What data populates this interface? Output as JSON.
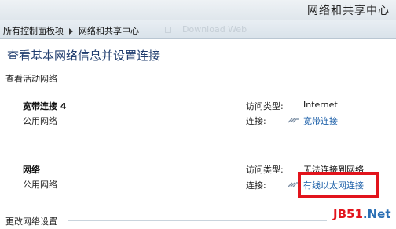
{
  "window": {
    "title": "网络和共享中心"
  },
  "address": {
    "crumb1": "所有控制面板项",
    "crumb2": "网络和共享中心",
    "ghost_text": "Download Web"
  },
  "page": {
    "title": "查看基本网络信息并设置连接"
  },
  "sections": {
    "active": "查看活动网络",
    "change": "更改网络设置"
  },
  "networks": [
    {
      "name": "宽带连接 4",
      "type": "公用网络",
      "access_label": "访问类型:",
      "access_value": "Internet",
      "conn_label": "连接:",
      "conn_value": "宽带连接"
    },
    {
      "name": "网络",
      "type": "公用网络",
      "access_label": "访问类型:",
      "access_value": "无法连接到网络",
      "conn_label": "连接:",
      "conn_value": "有线以太网连接"
    }
  ],
  "watermark": {
    "part1": "JB51",
    "part2": ".Net"
  },
  "colors": {
    "link": "#1a5ea8",
    "highlight": "#e2141c",
    "title": "#1f3c6e"
  }
}
